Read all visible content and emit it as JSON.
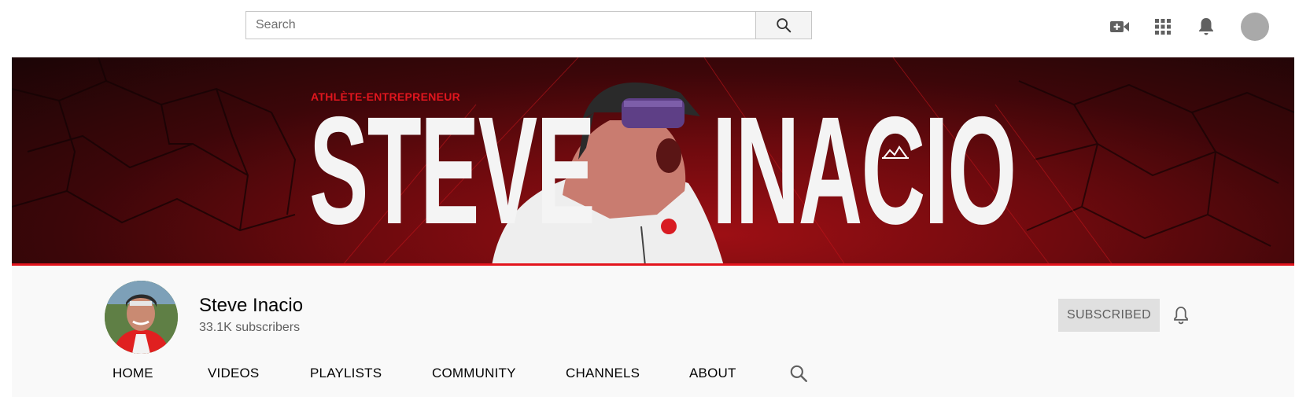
{
  "search": {
    "placeholder": "Search"
  },
  "header_icons": [
    "create-video-icon",
    "apps-grid-icon",
    "notifications-bell-icon",
    "account-avatar"
  ],
  "banner": {
    "tagline": "ATHLÈTE-ENTREPRENEUR",
    "first_name": "STEVE",
    "last_name": "INACIO",
    "accent_color": "#e3141d"
  },
  "channel": {
    "name": "Steve Inacio",
    "subscribers": "33.1K subscribers",
    "subscribe_label": "SUBSCRIBED"
  },
  "tabs": [
    {
      "label": "HOME"
    },
    {
      "label": "VIDEOS"
    },
    {
      "label": "PLAYLISTS"
    },
    {
      "label": "COMMUNITY"
    },
    {
      "label": "CHANNELS"
    },
    {
      "label": "ABOUT"
    }
  ]
}
